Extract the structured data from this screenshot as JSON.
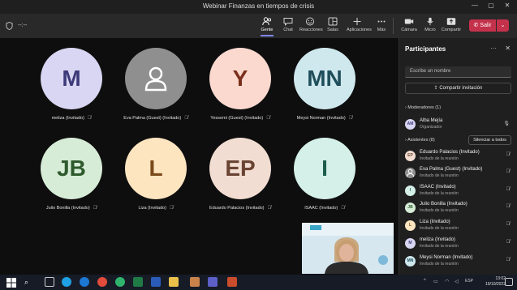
{
  "window": {
    "title": "Webinar Finanzas en tiempos de crisis"
  },
  "toolbar": {
    "timer": "--:--",
    "items": [
      {
        "label": "Gente",
        "icon": "people-icon"
      },
      {
        "label": "Chat",
        "icon": "chat-icon"
      },
      {
        "label": "Reacciones",
        "icon": "reactions-icon"
      },
      {
        "label": "Salas",
        "icon": "rooms-icon"
      },
      {
        "label": "Aplicaciones",
        "icon": "apps-icon"
      },
      {
        "label": "Más",
        "icon": "more-icon"
      },
      {
        "label": "Cámara",
        "icon": "camera-icon"
      },
      {
        "label": "Micro",
        "icon": "microphone-icon"
      },
      {
        "label": "Compartir",
        "icon": "share-icon"
      }
    ],
    "leave_label": "Salir"
  },
  "gallery": {
    "tiles": [
      {
        "initials": "M",
        "name": "meliza (Invitado)",
        "bg": "#d9d6f3",
        "fg": "#3d3a7a"
      },
      {
        "initials": "",
        "name": "Eva Palma (Guest) (Invitado)",
        "bg": "#8f8f8f",
        "fg": "#ffffff"
      },
      {
        "initials": "Y",
        "name": "Yessemi (Guest) (Invitado)",
        "bg": "#fbd9cf",
        "fg": "#7a2f1c"
      },
      {
        "initials": "MN",
        "name": "Meysi Norman (Invitado)",
        "bg": "#cfe8ee",
        "fg": "#1f4e5a"
      },
      {
        "initials": "JB",
        "name": "Julio Bonilla (Invitado)",
        "bg": "#d7ecd7",
        "fg": "#2e5a2e"
      },
      {
        "initials": "L",
        "name": "Liza (Invitado)",
        "bg": "#fde5c0",
        "fg": "#7a4a1a"
      },
      {
        "initials": "EP",
        "name": "Eduardo Palacios (Invitado)",
        "bg": "#f2ddd2",
        "fg": "#6a4433"
      },
      {
        "initials": "I",
        "name": "ISAAC (Invitado)",
        "bg": "#d4f0e8",
        "fg": "#1e5c4c"
      }
    ]
  },
  "panel": {
    "title": "Participantes",
    "search_placeholder": "Escribe un nombre",
    "share_invite": "Compartir invitación",
    "moderators_label": "Moderadores (1)",
    "moderators": [
      {
        "initials": "AM",
        "name": "Alba Mejía",
        "role": "Organizador",
        "bg": "#d9d6f3",
        "fg": "#3d3a7a"
      }
    ],
    "attendees_label": "Asistentes (8)",
    "silence_all": "Silenciar a todos",
    "attendees": [
      {
        "initials": "EP",
        "name": "Eduardo Palacios (Invitado)",
        "role": "Invitado de la reunión",
        "bg": "#f2ddd2",
        "fg": "#6a4433"
      },
      {
        "initials": "",
        "name": "Eva Palma (Guest) (Invitado)",
        "role": "Invitado de la reunión",
        "bg": "#8f8f8f",
        "fg": "#ffffff"
      },
      {
        "initials": "I",
        "name": "ISAAC (Invitado)",
        "role": "Invitado de la reunión",
        "bg": "#d4f0e8",
        "fg": "#1e5c4c"
      },
      {
        "initials": "JB",
        "name": "Julio Bonilla (Invitado)",
        "role": "Invitado de la reunión",
        "bg": "#d7ecd7",
        "fg": "#2e5a2e"
      },
      {
        "initials": "L",
        "name": "Liza (Invitado)",
        "role": "Invitado de la reunión",
        "bg": "#fde5c0",
        "fg": "#7a4a1a"
      },
      {
        "initials": "M",
        "name": "meliza (Invitado)",
        "role": "Invitado de la reunión",
        "bg": "#d9d6f3",
        "fg": "#3d3a7a"
      },
      {
        "initials": "MN",
        "name": "Meysi Norman (Invitado)",
        "role": "Invitado de la reunión",
        "bg": "#cfe8ee",
        "fg": "#1f4e5a"
      }
    ]
  },
  "taskbar": {
    "time": "13:02",
    "date": "19/10/2022",
    "lang": "ESP"
  },
  "colors": {
    "accent": "#7f85f5",
    "leave": "#c4314b"
  }
}
